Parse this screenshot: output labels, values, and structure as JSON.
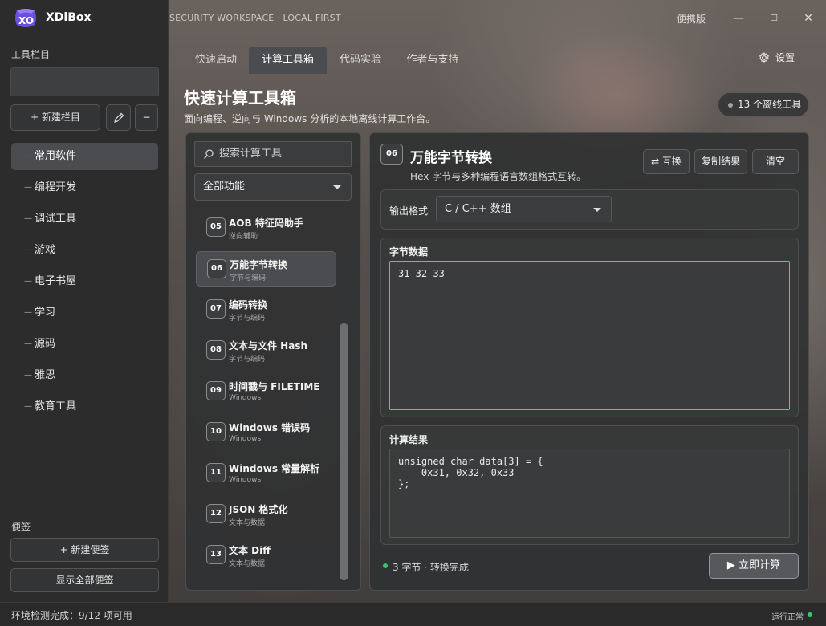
{
  "app": {
    "name": "XDiBox",
    "workspace": "SECURITY WORKSPACE · LOCAL FIRST",
    "edition": "便携版",
    "window_controls": [
      "—",
      "☐",
      "✕"
    ]
  },
  "sidebar": {
    "toolbar_label": "工具栏目",
    "new_column": "+ 新建栏目",
    "edit_icon": "pencil-icon",
    "remove": "−",
    "items": [
      {
        "label": "常用软件",
        "active": true
      },
      {
        "label": "编程开发"
      },
      {
        "label": "调试工具"
      },
      {
        "label": "游戏"
      },
      {
        "label": "电子书屋"
      },
      {
        "label": "学习"
      },
      {
        "label": "源码"
      },
      {
        "label": "雅思"
      },
      {
        "label": "教育工具"
      }
    ],
    "notes_label": "便签",
    "new_note": "+ 新建便签",
    "show_all_notes": "显示全部便签"
  },
  "tabs": [
    {
      "label": "快速启动"
    },
    {
      "label": "计算工具箱",
      "active": true
    },
    {
      "label": "代码实验"
    },
    {
      "label": "作者与支持"
    }
  ],
  "settings_label": "设置",
  "page": {
    "title": "快速计算工具箱",
    "subtitle": "面向编程、逆向与 Windows 分析的本地离线计算工作台。",
    "badge": "13 个离线工具"
  },
  "tool_list": {
    "search_placeholder": "搜索计算工具",
    "filter": "全部功能",
    "items": [
      {
        "num": "05",
        "name": "AOB 特征码助手",
        "cat": "逆向辅助"
      },
      {
        "num": "06",
        "name": "万能字节转换",
        "cat": "字节与编码",
        "active": true
      },
      {
        "num": "07",
        "name": "编码转换",
        "cat": "字节与编码"
      },
      {
        "num": "08",
        "name": "文本与文件 Hash",
        "cat": "字节与编码"
      },
      {
        "num": "09",
        "name": "时间戳与 FILETIME",
        "cat": "Windows"
      },
      {
        "num": "10",
        "name": "Windows 错误码",
        "cat": "Windows"
      },
      {
        "num": "11",
        "name": "Windows 常量解析",
        "cat": "Windows"
      },
      {
        "num": "12",
        "name": "JSON 格式化",
        "cat": "文本与数据"
      },
      {
        "num": "13",
        "name": "文本 Diff",
        "cat": "文本与数据"
      }
    ]
  },
  "detail": {
    "num": "06",
    "title": "万能字节转换",
    "subtitle": "Hex 字节与多种编程语言数组格式互转。",
    "swap": "⇄ 互换",
    "copy": "复制结果",
    "clear": "清空",
    "output_format_label": "输出格式",
    "output_format": "C / C++ 数组",
    "input_label": "字节数据",
    "input_value": "31 32 33",
    "result_label": "计算结果",
    "result_value": "unsigned char data[3] = {\n    0x31, 0x32, 0x33\n};",
    "status": "3 字节 · 转换完成",
    "run": "▶ 立即计算"
  },
  "status_bar": {
    "left": "环境检测完成：9/12 项可用",
    "right": "运行正常"
  }
}
